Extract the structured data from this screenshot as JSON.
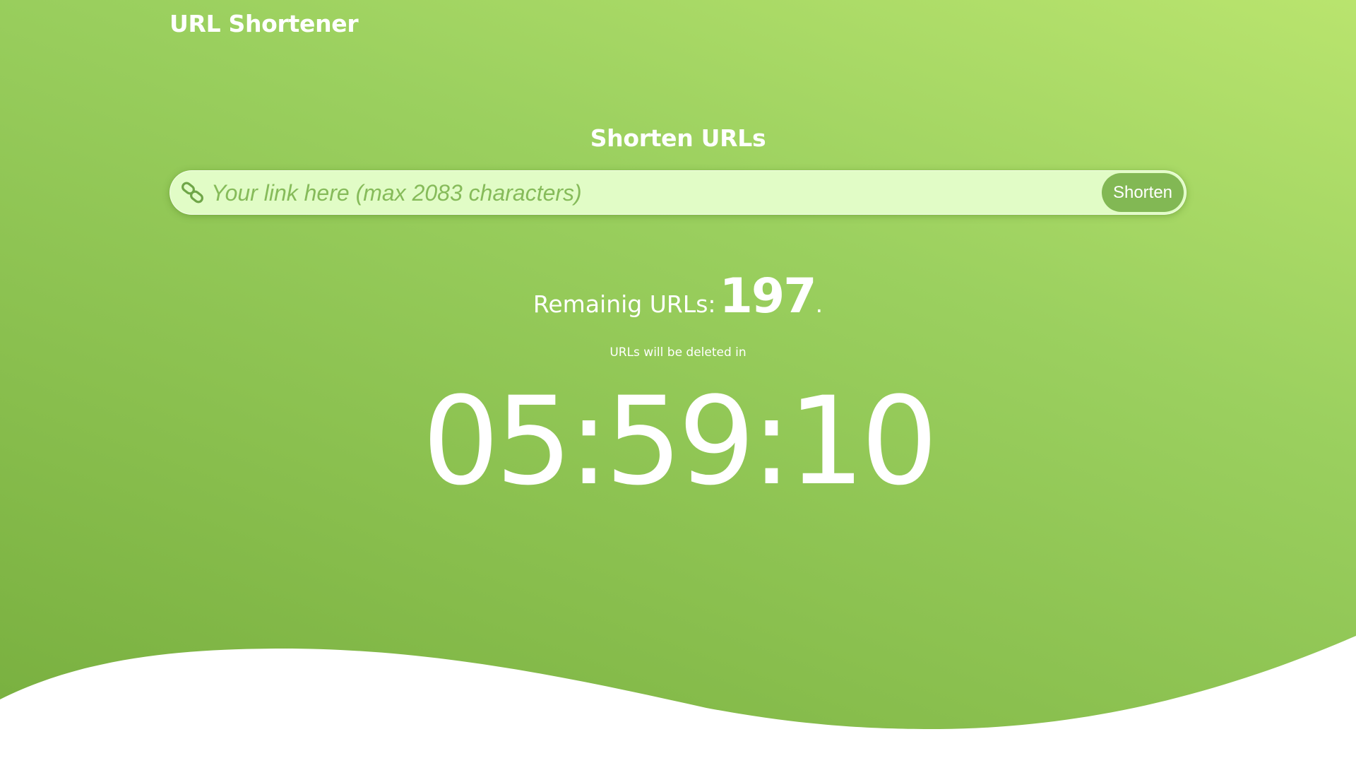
{
  "header": {
    "brand": "URL Shortener"
  },
  "main": {
    "heading": "Shorten URLs",
    "search": {
      "placeholder": "Your link here (max 2083 characters)",
      "value": "",
      "button_label": "Shorten",
      "icon": "link-icon"
    },
    "remaining": {
      "label": "Remainig URLs:",
      "count": "197",
      "suffix": "."
    },
    "deletion_note": "URLs will be deleted in",
    "timer": "05:59:10"
  },
  "colors": {
    "gradient_light": "#b9e46e",
    "gradient_dark": "#77ae3e",
    "input_bg": "#e1fcc6",
    "button_bg": "#82b854",
    "text": "#ffffff"
  }
}
